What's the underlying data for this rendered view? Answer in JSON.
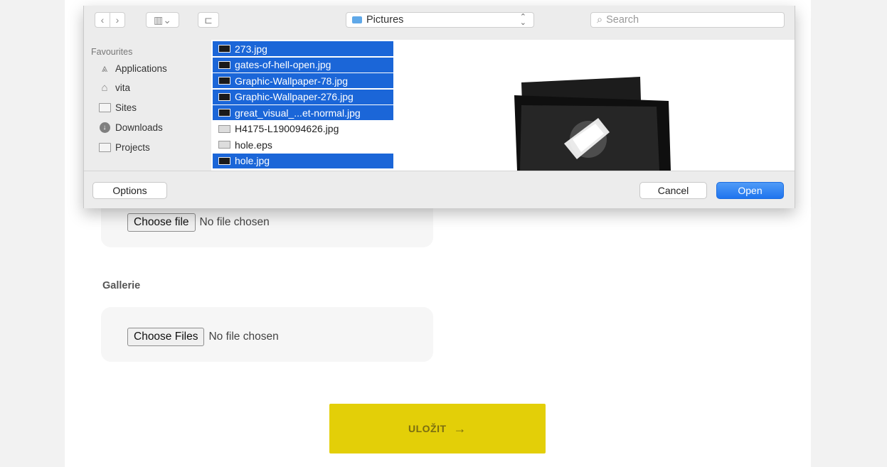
{
  "form": {
    "image_field": {
      "button_label": "Choose file",
      "status": "No file chosen"
    },
    "gallery_label": "Gallerie",
    "gallery_field": {
      "button_label": "Choose Files",
      "status": "No file chosen"
    },
    "save_button": {
      "label": "ULOŽIT",
      "arrow": "→"
    }
  },
  "dialog": {
    "toolbar": {
      "back_glyph": "‹",
      "forward_glyph": "›",
      "view_glyph": "▥⌄",
      "folder_glyph": "⊏",
      "location": "Pictures",
      "location_glyph": "⌃⌄",
      "search_placeholder": "Search",
      "search_glyph": "⌕"
    },
    "sidebar": {
      "heading": "Favourites",
      "items": [
        {
          "label": "Applications",
          "icon": "applications-icon",
          "glyph": "⩓"
        },
        {
          "label": "vita",
          "icon": "home-icon",
          "glyph": "⌂"
        },
        {
          "label": "Sites",
          "icon": "folder-icon"
        },
        {
          "label": "Downloads",
          "icon": "downloads-icon",
          "glyph": "↓"
        },
        {
          "label": "Projects",
          "icon": "folder-icon"
        }
      ]
    },
    "files": [
      {
        "name": "273.jpg",
        "selected": true
      },
      {
        "name": "gates-of-hell-open.jpg",
        "selected": true
      },
      {
        "name": "Graphic-Wallpaper-78.jpg",
        "selected": true
      },
      {
        "name": "Graphic-Wallpaper-276.jpg",
        "selected": true
      },
      {
        "name": "great_visual_...et-normal.jpg",
        "selected": true
      },
      {
        "name": "H4175-L190094626.jpg",
        "selected": false
      },
      {
        "name": "hole.eps",
        "selected": false
      },
      {
        "name": "hole.jpg",
        "selected": true
      }
    ],
    "buttons": {
      "options": "Options",
      "cancel": "Cancel",
      "open": "Open"
    },
    "colors": {
      "selection": "#1b66d8",
      "open_button": "#1f74ee",
      "save_button": "#e3cf08"
    }
  }
}
